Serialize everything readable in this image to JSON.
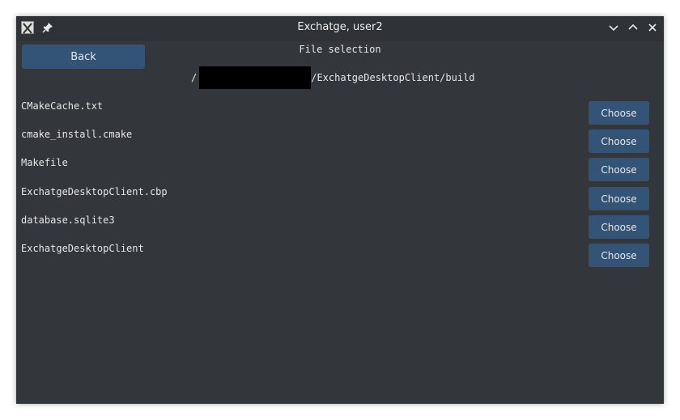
{
  "window": {
    "title": "Exchatge, user2"
  },
  "page": {
    "back_label": "Back",
    "heading": "File selection",
    "path_prefix": "/",
    "path_suffix": "/ExchatgeDesktopClient/build"
  },
  "files": [
    {
      "name": "CMakeCache.txt",
      "button": "Choose"
    },
    {
      "name": "cmake_install.cmake",
      "button": "Choose"
    },
    {
      "name": "Makefile",
      "button": "Choose"
    },
    {
      "name": "ExchatgeDesktopClient.cbp",
      "button": "Choose"
    },
    {
      "name": "database.sqlite3",
      "button": "Choose"
    },
    {
      "name": "ExchatgeDesktopClient",
      "button": "Choose"
    }
  ],
  "colors": {
    "background": "#33363a",
    "button": "#335476",
    "text": "#e6e6e6"
  }
}
